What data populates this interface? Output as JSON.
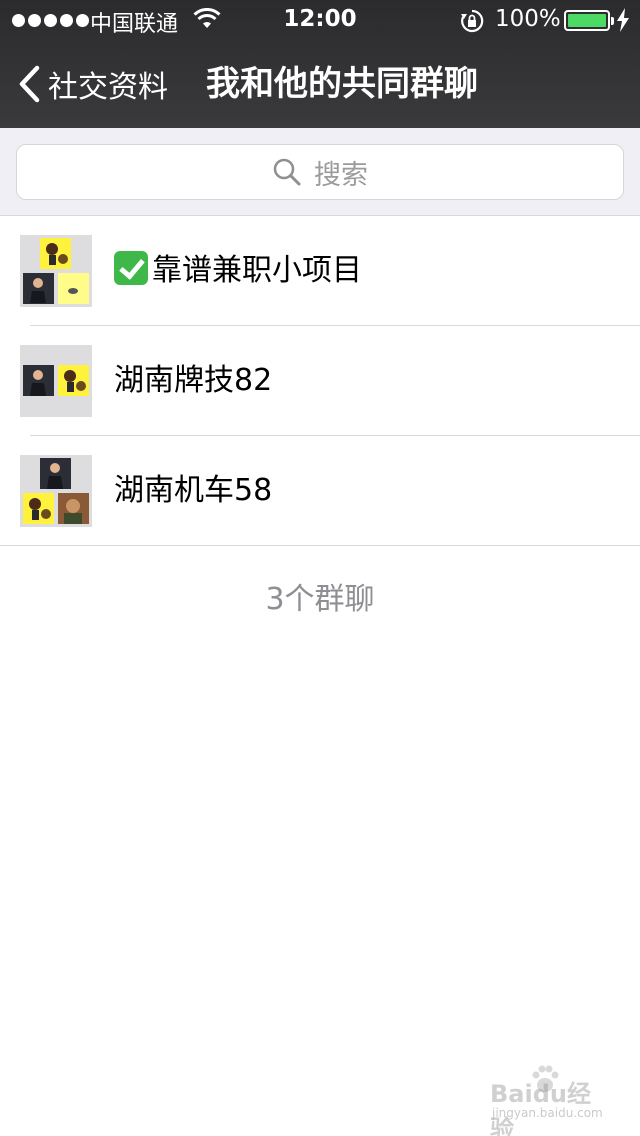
{
  "status_bar": {
    "carrier": "中国联通",
    "time": "12:00",
    "battery": "100%"
  },
  "nav": {
    "back_label": "社交资料",
    "title": "我和他的共同群聊"
  },
  "search": {
    "placeholder": "搜索"
  },
  "groups": [
    {
      "name": "靠谱兼职小项目",
      "prefix_icon": "check-mark-emoji"
    },
    {
      "name": "湖南牌技82"
    },
    {
      "name": "湖南机车58"
    }
  ],
  "footer": {
    "count_label": "3个群聊"
  },
  "watermark": {
    "logo_text": "Baidu经验",
    "url": "jingyan.baidu.com"
  },
  "colors": {
    "nav_background": "#2b2b2d",
    "search_background": "#f0eff5",
    "battery_fill": "#4cd964",
    "secondary_text": "#8e8e93"
  }
}
